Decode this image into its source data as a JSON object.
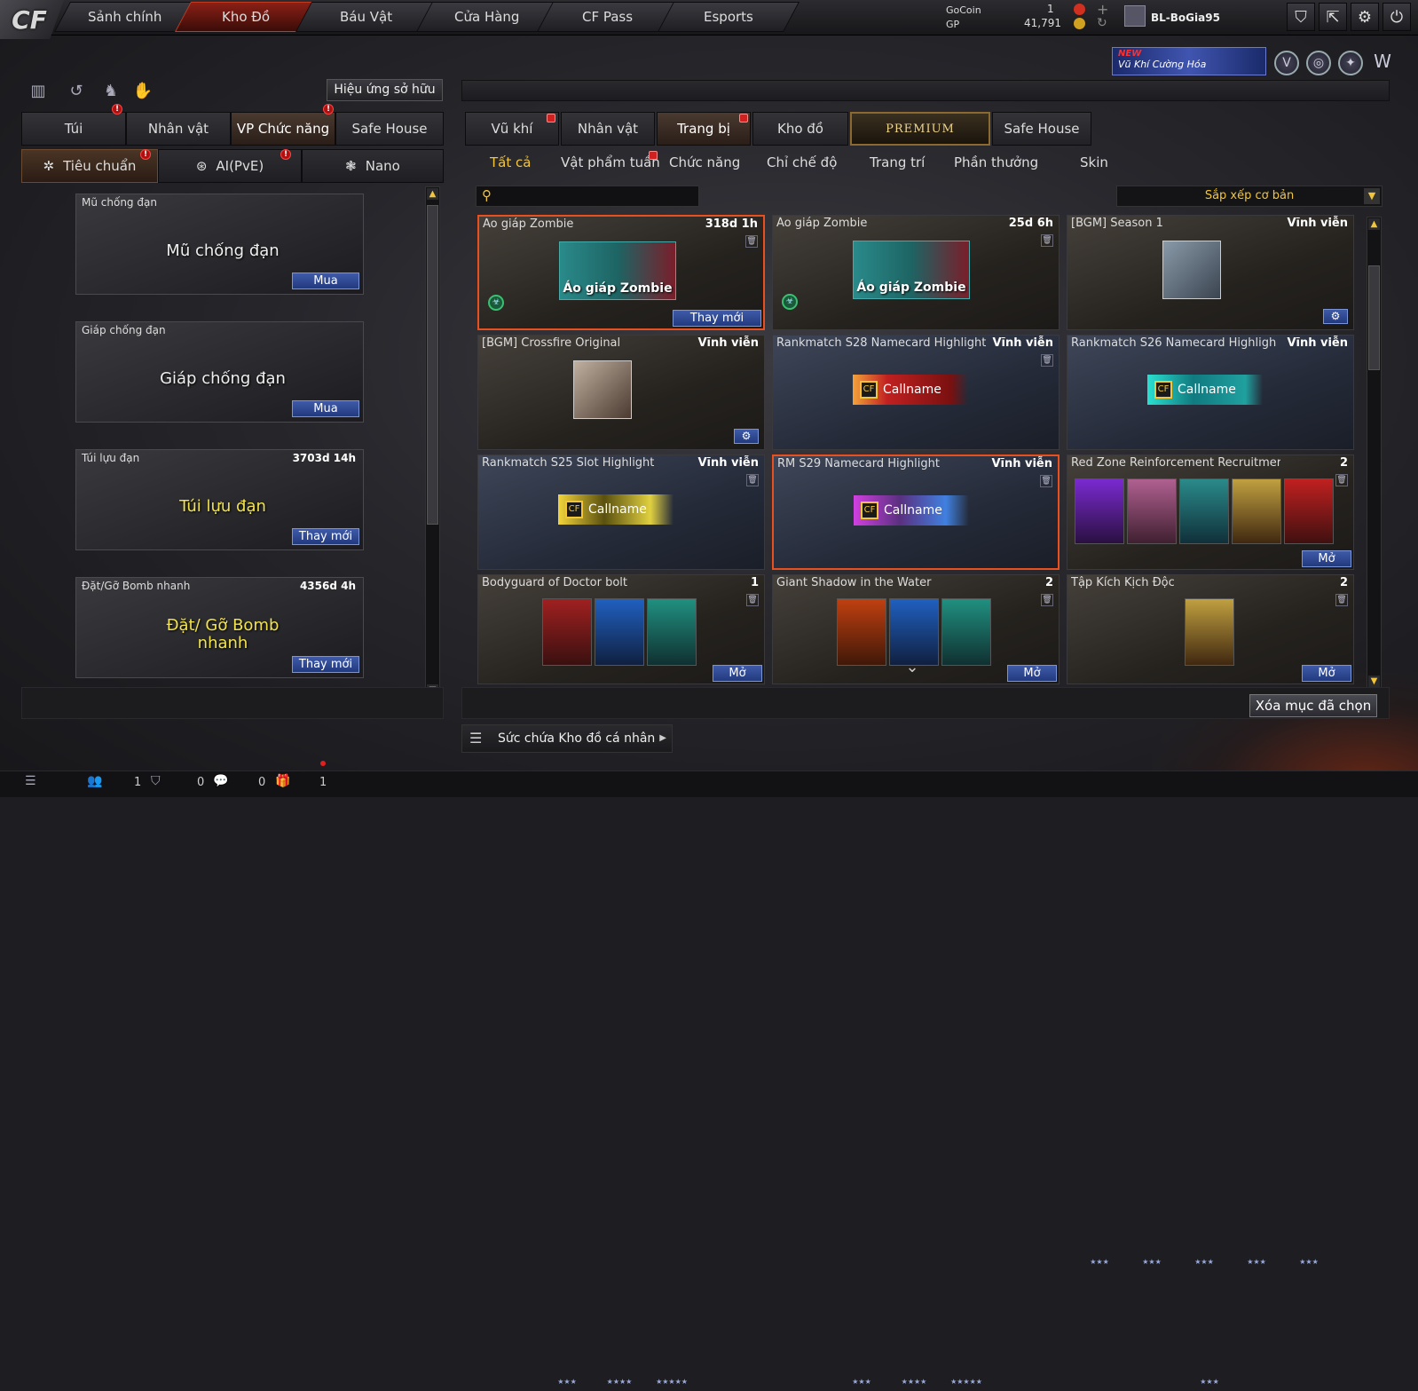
{
  "nav": {
    "logo": "CF",
    "tabs": [
      "Sảnh chính",
      "Kho Đồ",
      "Báu Vật",
      "Cửa Hàng",
      "CF Pass",
      "Esports"
    ]
  },
  "currency": {
    "gocoin_label": "GoCoin",
    "gocoin_value": "1",
    "gp_label": "GP",
    "gp_value": "41,791"
  },
  "user": {
    "name": "BL-BoGia95"
  },
  "promo": {
    "badge": "NEW",
    "text": "Vũ Khí Cường Hóa"
  },
  "left": {
    "effect_button": "Hiệu ứng sở hữu",
    "tabs": [
      "Túi",
      "Nhân vật",
      "VP Chức năng",
      "Safe House"
    ],
    "subtabs": [
      "Tiêu chuẩn",
      "AI(PvE)",
      "Nano"
    ],
    "items": [
      {
        "name": "Mũ chống đạn",
        "duration": "",
        "art": "Mũ chống đạn",
        "action": "Mua"
      },
      {
        "name": "Giáp chống đạn",
        "duration": "",
        "art": "Giáp chống đạn",
        "action": "Mua"
      },
      {
        "name": "Túi lựu đạn",
        "duration": "3703d 14h",
        "art": "Túi lựu đạn",
        "action": "Thay mới"
      },
      {
        "name": "Đặt/Gỡ Bomb nhanh",
        "duration": "4356d 4h",
        "art": "Đặt/ Gỡ Bomb nhanh",
        "action": "Thay mới"
      }
    ]
  },
  "right": {
    "tabs": [
      "Vũ khí",
      "Nhân vật",
      "Trang bị",
      "Kho đồ",
      "PREMIUM",
      "Safe House"
    ],
    "categories": [
      "Tất cả",
      "Vật phẩm tuần",
      "Chức năng",
      "Chỉ chế độ",
      "Trang trí",
      "Phần thưởng",
      "Skin"
    ],
    "search_placeholder": "",
    "sort_label": "Sắp xếp cơ bản",
    "cards": [
      {
        "title": "Áo giáp Zombie",
        "duration": "318d 1h",
        "art": "Áo giáp Zombie",
        "action": "Thay mới"
      },
      {
        "title": "Áo giáp Zombie",
        "duration": "25d 6h",
        "art": "Áo giáp Zombie",
        "action": ""
      },
      {
        "title": "[BGM] Season 1",
        "duration": "Vĩnh viễn",
        "art": "",
        "action": ""
      },
      {
        "title": "[BGM] Crossfire Original",
        "duration": "Vĩnh viễn",
        "art": "",
        "action": ""
      },
      {
        "title": "Rankmatch S28 Namecard Highlight",
        "duration": "Vĩnh viễn",
        "art": "Callname",
        "action": ""
      },
      {
        "title": "Rankmatch S26 Namecard Highligh",
        "duration": "Vĩnh viễn",
        "art": "Callname",
        "action": ""
      },
      {
        "title": "Rankmatch S25 Slot Highlight",
        "duration": "Vĩnh viễn",
        "art": "Callname",
        "action": ""
      },
      {
        "title": "RM S29 Namecard Highlight",
        "duration": "Vĩnh viễn",
        "art": "Callname",
        "action": ""
      },
      {
        "title": "Red Zone Reinforcement Recruitmer",
        "duration": "2",
        "art": "",
        "action": "Mở"
      },
      {
        "title": "Bodyguard of Doctor bolt",
        "duration": "1",
        "art": "",
        "action": "Mở"
      },
      {
        "title": "Giant Shadow in the Water",
        "duration": "2",
        "art": "",
        "action": "Mở"
      },
      {
        "title": "Tập Kích Kịch Độc",
        "duration": "2",
        "art": "",
        "action": "Mở"
      }
    ],
    "clear_button": "Xóa mục đã chọn",
    "storage_label": "Sức chứa Kho đồ cá nhân"
  },
  "status": {
    "count1": "1",
    "count2": "0",
    "count3": "0",
    "count4": "1"
  }
}
